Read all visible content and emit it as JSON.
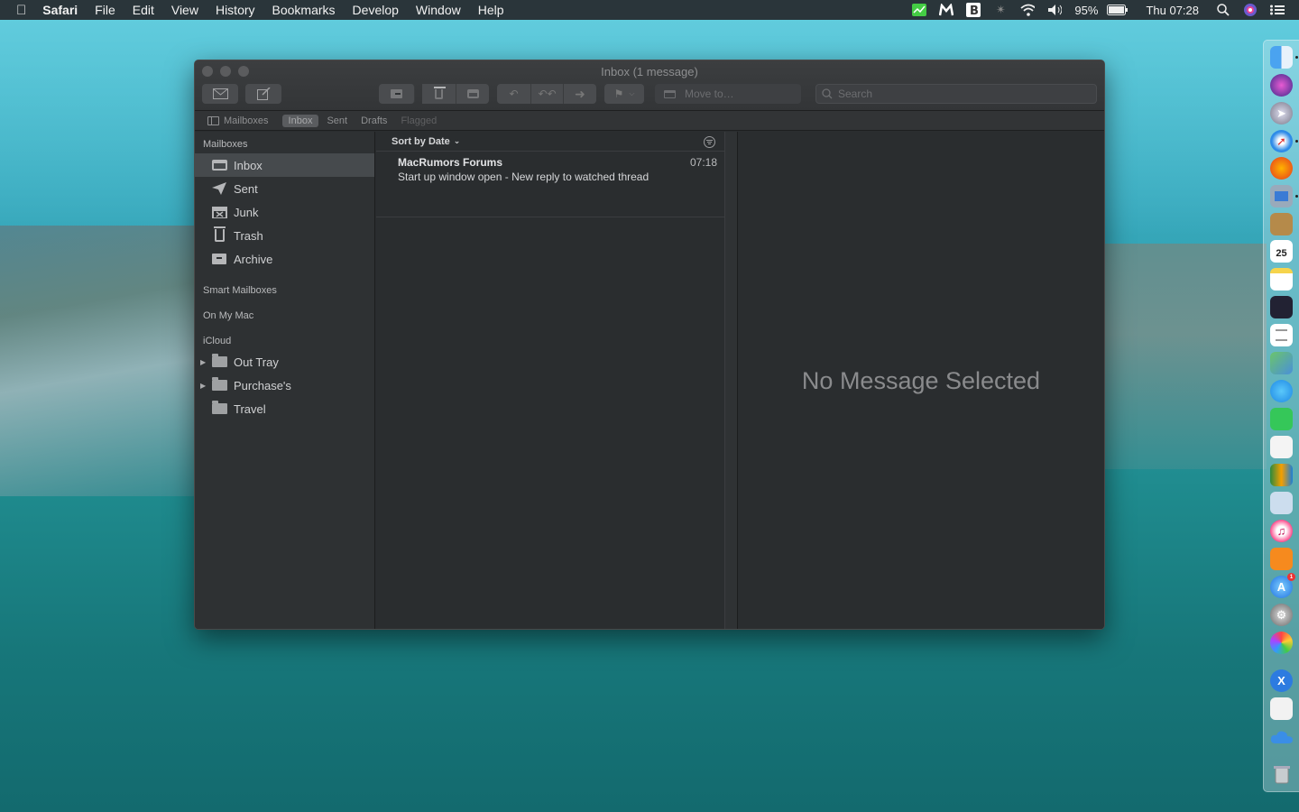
{
  "menubar": {
    "app_name": "Safari",
    "menus": [
      "File",
      "Edit",
      "View",
      "History",
      "Bookmarks",
      "Develop",
      "Window",
      "Help"
    ],
    "battery": "95%",
    "clock": "Thu 07:28"
  },
  "window": {
    "title": "Inbox (1 message)",
    "toolbar": {
      "move_to_label": "Move to…",
      "search_placeholder": "Search"
    },
    "favorites_bar": {
      "mailboxes": "Mailboxes",
      "inbox": "Inbox",
      "sent": "Sent",
      "drafts": "Drafts",
      "flagged": "Flagged"
    },
    "sidebar": {
      "mailboxes_header": "Mailboxes",
      "mailboxes": [
        {
          "label": "Inbox",
          "icon": "inbox-tray-icon",
          "selected": true
        },
        {
          "label": "Sent",
          "icon": "paper-plane-icon"
        },
        {
          "label": "Junk",
          "icon": "junk-icon"
        },
        {
          "label": "Trash",
          "icon": "trash-icon"
        },
        {
          "label": "Archive",
          "icon": "archive-box-icon"
        }
      ],
      "smart_mailboxes_header": "Smart Mailboxes",
      "on_my_mac_header": "On My Mac",
      "icloud_header": "iCloud",
      "icloud_folders": [
        {
          "label": "Out Tray",
          "icon": "folder-icon",
          "collapsed": true
        },
        {
          "label": "Purchase's",
          "icon": "folder-icon",
          "collapsed": true
        },
        {
          "label": "Travel",
          "icon": "folder-icon"
        }
      ]
    },
    "message_list": {
      "sort_label": "Sort by Date",
      "messages": [
        {
          "sender": "MacRumors Forums",
          "time": "07:18",
          "subject": "Start up window open - New reply to watched thread"
        }
      ]
    },
    "viewer": {
      "empty_text": "No Message Selected"
    }
  },
  "dock": {
    "calendar_day": "25",
    "app_store_badge": "1"
  }
}
